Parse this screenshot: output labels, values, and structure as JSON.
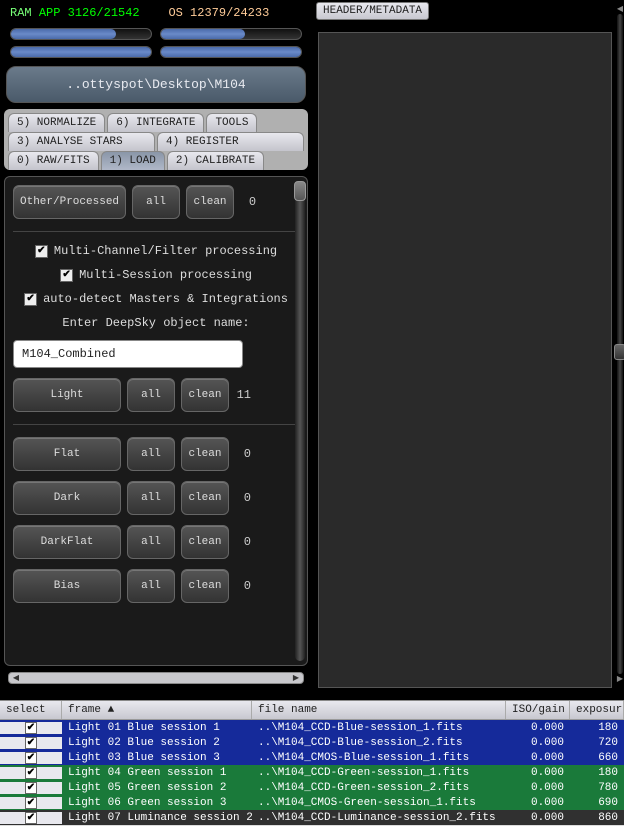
{
  "ram_row": {
    "ram": "RAM",
    "app": "APP 3126/21542",
    "os": "OS 12379/24233"
  },
  "path": "..ottyspot\\Desktop\\M104",
  "tabs": {
    "row1": [
      "5) NORMALIZE",
      "6) INTEGRATE",
      "TOOLS"
    ],
    "row2": [
      "3) ANALYSE STARS",
      "4) REGISTER"
    ],
    "row3": [
      "0) RAW/FITS",
      "1) LOAD",
      "2) CALIBRATE"
    ]
  },
  "selected_tab": "1) LOAD",
  "groups": {
    "other": {
      "label": "Other/Processed",
      "all": "all",
      "clean": "clean",
      "count": "0"
    },
    "checks": [
      "Multi-Channel/Filter processing",
      "Multi-Session processing",
      "auto-detect Masters & Integrations"
    ],
    "deep_label": "Enter DeepSky object name:",
    "deep_value": "M104_Combined",
    "light": {
      "label": "Light",
      "all": "all",
      "clean": "clean",
      "count": "11"
    },
    "flat": {
      "label": "Flat",
      "all": "all",
      "clean": "clean",
      "count": "0"
    },
    "dark": {
      "label": "Dark",
      "all": "all",
      "clean": "clean",
      "count": "0"
    },
    "darkflat": {
      "label": "DarkFlat",
      "all": "all",
      "clean": "clean",
      "count": "0"
    },
    "bias": {
      "label": "Bias",
      "all": "all",
      "clean": "clean",
      "count": "0"
    }
  },
  "right_panel": {
    "header_btn": "HEADER/METADATA"
  },
  "table": {
    "headers": {
      "select": "select",
      "frame": "frame",
      "file": "file name",
      "iso": "ISO/gain",
      "exp": "exposur"
    },
    "rows": [
      {
        "cls": "blue",
        "frame": "Light 01 Blue session 1",
        "file": "..\\M104_CCD-Blue-session_1.fits",
        "iso": "0.000",
        "exp": "180"
      },
      {
        "cls": "blue",
        "frame": "Light 02 Blue session 2",
        "file": "..\\M104_CCD-Blue-session_2.fits",
        "iso": "0.000",
        "exp": "720"
      },
      {
        "cls": "blue",
        "frame": "Light 03 Blue session 3",
        "file": "..\\M104_CMOS-Blue-session_1.fits",
        "iso": "0.000",
        "exp": "660"
      },
      {
        "cls": "green",
        "frame": "Light 04 Green session 1",
        "file": "..\\M104_CCD-Green-session_1.fits",
        "iso": "0.000",
        "exp": "180"
      },
      {
        "cls": "green",
        "frame": "Light 05 Green session 2",
        "file": "..\\M104_CCD-Green-session_2.fits",
        "iso": "0.000",
        "exp": "780"
      },
      {
        "cls": "green",
        "frame": "Light 06 Green session 3",
        "file": "..\\M104_CMOS-Green-session_1.fits",
        "iso": "0.000",
        "exp": "690"
      },
      {
        "cls": "lum",
        "frame": "Light 07 Luminance session 2",
        "file": "..\\M104_CCD-Luminance-session_2.fits",
        "iso": "0.000",
        "exp": "860"
      }
    ]
  }
}
